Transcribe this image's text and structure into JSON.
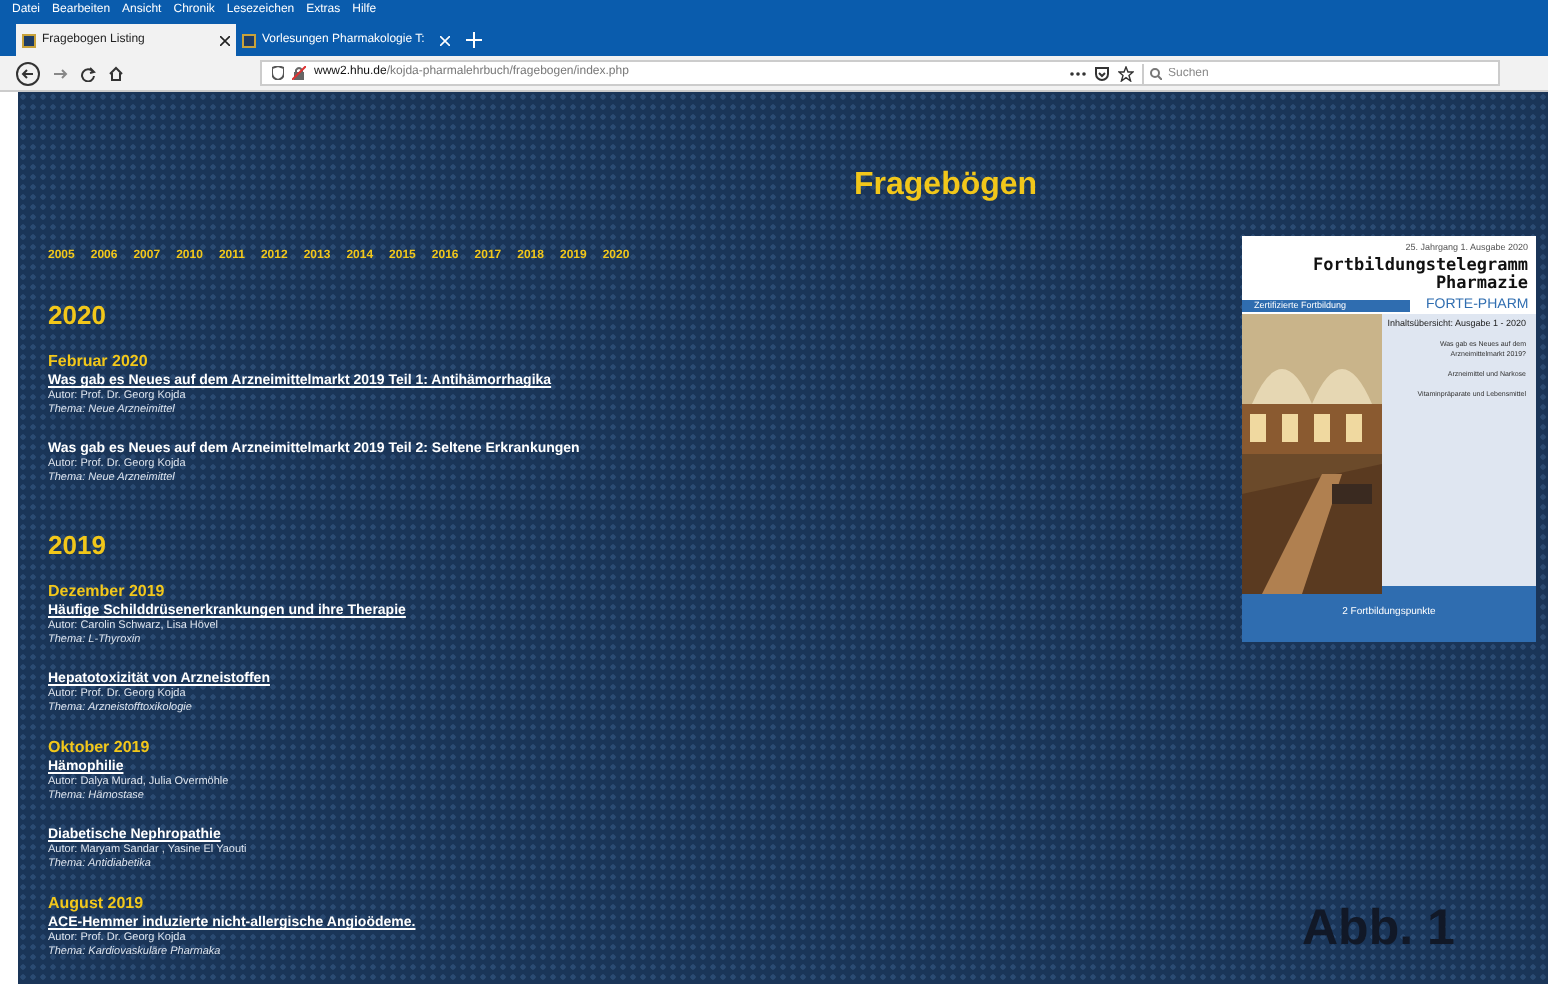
{
  "menu": [
    "Datei",
    "Bearbeiten",
    "Ansicht",
    "Chronik",
    "Lesezeichen",
    "Extras",
    "Hilfe"
  ],
  "tabs": [
    {
      "label": "Fragebogen Listing",
      "selected": true
    },
    {
      "label": "Vorlesungen Pharmakologie T:",
      "selected": false
    }
  ],
  "address": {
    "host": "www2.hhu.de",
    "path": "/kojda-pharmalehrbuch/fragebogen/index.php"
  },
  "search": {
    "placeholder": "Suchen"
  },
  "page": {
    "title": "Fragebögen",
    "year_links": [
      "2005",
      "2006",
      "2007",
      "2010",
      "2011",
      "2012",
      "2013",
      "2014",
      "2015",
      "2016",
      "2017",
      "2018",
      "2019",
      "2020"
    ],
    "sections": [
      {
        "year": "2020",
        "groups": [
          {
            "month": "Februar 2020",
            "items": [
              {
                "title": "Was gab es Neues auf dem Arzneimittelmarkt 2019 Teil 1: Antihämorrhagika",
                "link": true,
                "author": "Autor: Prof. Dr. Georg Kojda",
                "theme": "Thema: Neue Arzneimittel"
              },
              {
                "title": "Was gab es Neues auf dem Arzneimittelmarkt 2019 Teil 2: Seltene Erkrankungen",
                "link": false,
                "author": "Autor: Prof. Dr. Georg Kojda",
                "theme": "Thema: Neue Arzneimittel"
              }
            ]
          }
        ]
      },
      {
        "year": "2019",
        "groups": [
          {
            "month": "Dezember 2019",
            "items": [
              {
                "title": "Häufige Schilddrüsenerkrankungen und ihre Therapie",
                "link": true,
                "author": "Autor: Carolin Schwarz, Lisa Hövel",
                "theme": "Thema: L-Thyroxin"
              },
              {
                "title": "Hepatotoxizität von Arzneistoffen",
                "link": true,
                "author": "Autor: Prof. Dr. Georg Kojda",
                "theme": "Thema: Arzneistofftoxikologie"
              }
            ]
          },
          {
            "month": "Oktober 2019",
            "items": [
              {
                "title": "Hämophilie",
                "link": true,
                "author": "Autor: Dalya Murad, Julia Overmöhle",
                "theme": "Thema: Hämostase"
              },
              {
                "title": "Diabetische Nephropathie",
                "link": true,
                "author": "Autor: Maryam Sandar , Yasine El Yaouti",
                "theme": "Thema: Antidiabetika"
              }
            ]
          },
          {
            "month": "August 2019",
            "items": [
              {
                "title": "ACE-Hemmer induzierte nicht-allergische Angioödeme.",
                "link": true,
                "author": "Autor: Prof. Dr. Georg Kojda",
                "theme": "Thema: Kardiovaskuläre Pharmaka"
              }
            ]
          }
        ]
      }
    ]
  },
  "cover": {
    "issue": "25. Jahrgang 1. Ausgabe 2020",
    "title_lines": [
      "Fortbildungstelegramm",
      "Pharmazie"
    ],
    "band": "Zertifizierte Fortbildung",
    "brand": "FORTE-PHARM",
    "contents_title": "Inhaltsübersicht: Ausgabe 1 - 2020",
    "contents": [
      "Was gab es Neues auf dem Arzneimittelmarkt 2019?",
      "Arzneimittel und Narkose",
      "Vitaminpräparate und Lebensmittel"
    ],
    "footer": "2 Fortbildungspunkte"
  },
  "figure_label": "Abb. 1"
}
